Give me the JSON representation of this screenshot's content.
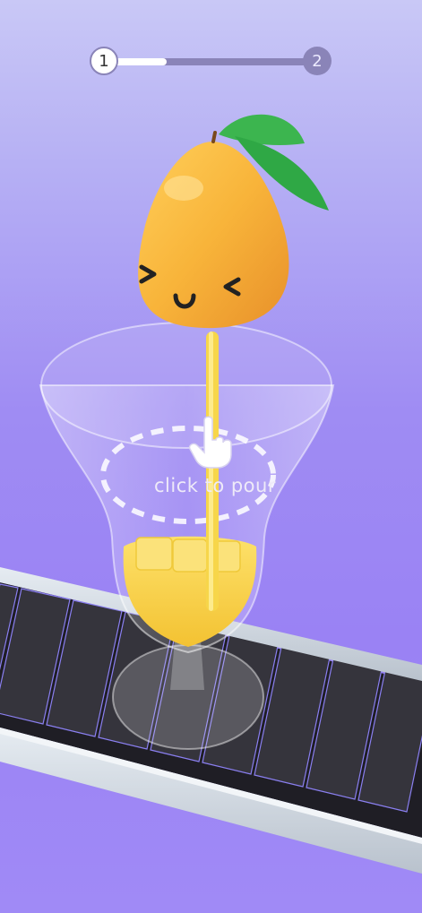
{
  "progress": {
    "current_level": "1",
    "next_level": "2",
    "fill_fraction": 0.29,
    "track_color": "#8a84b8",
    "fill_color": "#ffffff"
  },
  "hint": {
    "text": "click to pour"
  },
  "icons": {
    "pointer": "hand-pointer-icon",
    "fruit": "mango-character-icon"
  },
  "colors": {
    "background_top": "#c9c8f6",
    "background_bottom": "#9a82f4",
    "fruit": "#f8b43a",
    "leaf": "#34b04a",
    "juice": "#f7d64a",
    "conveyor_slat": "#2f2e35",
    "conveyor_rail": "#d5dde6"
  }
}
